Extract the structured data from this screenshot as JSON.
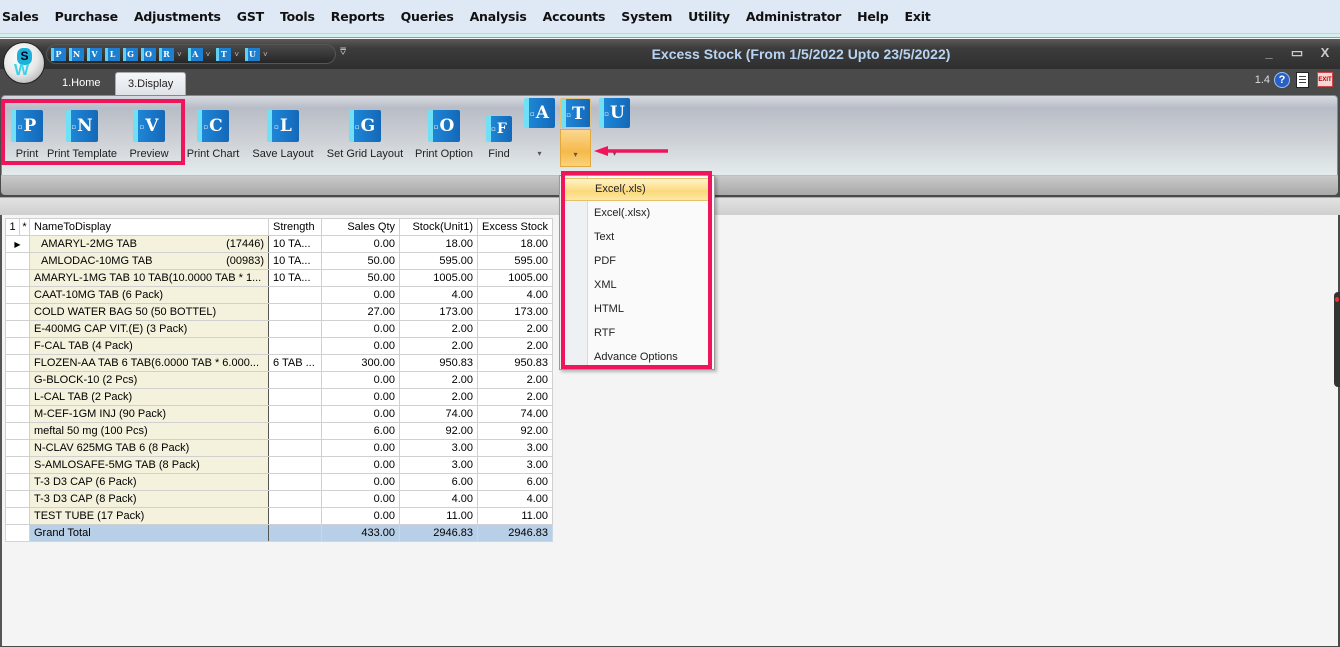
{
  "menu": [
    "Sales",
    "Purchase",
    "Adjustments",
    "GST",
    "Tools",
    "Reports",
    "Queries",
    "Analysis",
    "Accounts",
    "System",
    "Utility",
    "Administrator",
    "Help",
    "Exit"
  ],
  "window": {
    "title": "Excess Stock (From 1/5/2022 Upto 23/5/2022)",
    "controls": {
      "minimize": "_",
      "maximize": "▭",
      "close": "X"
    },
    "version": "1.4",
    "logo_letter": "S",
    "logo_mark": "W"
  },
  "quick_access": [
    {
      "letter": "P",
      "has_menu": false
    },
    {
      "letter": "N",
      "has_menu": false
    },
    {
      "letter": "V",
      "has_menu": false
    },
    {
      "letter": "L",
      "has_menu": false
    },
    {
      "letter": "G",
      "has_menu": false
    },
    {
      "letter": "O",
      "has_menu": false
    },
    {
      "letter": "R",
      "has_menu": true
    },
    {
      "letter": "A",
      "has_menu": true
    },
    {
      "letter": "T",
      "has_menu": true
    },
    {
      "letter": "U",
      "has_menu": true
    }
  ],
  "tabs": [
    {
      "label": "1.Home",
      "active": false
    },
    {
      "label": "3.Display",
      "active": true
    }
  ],
  "ribbon": {
    "buttons": [
      {
        "letter": "P",
        "label": "Print"
      },
      {
        "letter": "N",
        "label": "Print Template"
      },
      {
        "letter": "V",
        "label": "Preview"
      },
      {
        "letter": "C",
        "label": "Print Chart"
      },
      {
        "letter": "L",
        "label": "Save Layout"
      },
      {
        "letter": "G",
        "label": "Set Grid Layout"
      },
      {
        "letter": "O",
        "label": "Print Option"
      },
      {
        "letter": "F",
        "label": "Find"
      }
    ],
    "split_buttons": [
      {
        "letter": "A",
        "arrow": "▾"
      },
      {
        "letter": "T",
        "arrow": "▾"
      },
      {
        "letter": "U",
        "arrow": "▾"
      }
    ]
  },
  "export_menu": {
    "items": [
      "Excel(.xls)",
      "Excel(.xlsx)",
      "Text",
      "PDF",
      "XML",
      "HTML",
      "RTF",
      "Advance Options"
    ],
    "hovered": "Excel(.xls)"
  },
  "grid": {
    "header_prefix": [
      "1",
      "*"
    ],
    "columns": [
      "NameToDisplay",
      "Strength",
      "Sales Qty",
      "Stock(Unit1)",
      "Excess Stock"
    ],
    "current_row_marker": "▶",
    "rows": [
      {
        "name": "AMARYL-2MG TAB",
        "code": "(17446)",
        "strength": "10 TA...",
        "sales_qty": "0.00",
        "stock": "18.00",
        "excess": "18.00"
      },
      {
        "name": "AMLODAC-10MG TAB",
        "code": "(00983)",
        "strength": "10 TA...",
        "sales_qty": "50.00",
        "stock": "595.00",
        "excess": "595.00"
      },
      {
        "name": "AMARYL-1MG TAB 10 TAB(10.0000 TAB * 1...",
        "code": "",
        "strength": "10 TA...",
        "sales_qty": "50.00",
        "stock": "1005.00",
        "excess": "1005.00"
      },
      {
        "name": "CAAT-10MG TAB (6 Pack)",
        "code": "",
        "strength": "",
        "sales_qty": "0.00",
        "stock": "4.00",
        "excess": "4.00"
      },
      {
        "name": "COLD WATER BAG 50 (50 BOTTEL)",
        "code": "",
        "strength": "",
        "sales_qty": "27.00",
        "stock": "173.00",
        "excess": "173.00"
      },
      {
        "name": "E-400MG CAP VIT.(E) (3 Pack)",
        "code": "",
        "strength": "",
        "sales_qty": "0.00",
        "stock": "2.00",
        "excess": "2.00"
      },
      {
        "name": "F-CAL TAB (4 Pack)",
        "code": "",
        "strength": "",
        "sales_qty": "0.00",
        "stock": "2.00",
        "excess": "2.00"
      },
      {
        "name": "FLOZEN-AA TAB 6 TAB(6.0000 TAB * 6.000...",
        "code": "",
        "strength": "6 TAB ...",
        "sales_qty": "300.00",
        "stock": "950.83",
        "excess": "950.83"
      },
      {
        "name": "G-BLOCK-10 (2 Pcs)",
        "code": "",
        "strength": "",
        "sales_qty": "0.00",
        "stock": "2.00",
        "excess": "2.00"
      },
      {
        "name": "L-CAL TAB (2 Pack)",
        "code": "",
        "strength": "",
        "sales_qty": "0.00",
        "stock": "2.00",
        "excess": "2.00"
      },
      {
        "name": "M-CEF-1GM INJ (90 Pack)",
        "code": "",
        "strength": "",
        "sales_qty": "0.00",
        "stock": "74.00",
        "excess": "74.00"
      },
      {
        "name": "meftal 50 mg (100 Pcs)",
        "code": "",
        "strength": "",
        "sales_qty": "6.00",
        "stock": "92.00",
        "excess": "92.00"
      },
      {
        "name": "N-CLAV 625MG TAB  6 (8 Pack)",
        "code": "",
        "strength": "",
        "sales_qty": "0.00",
        "stock": "3.00",
        "excess": "3.00"
      },
      {
        "name": "S-AMLOSAFE-5MG TAB (8 Pack)",
        "code": "",
        "strength": "",
        "sales_qty": "0.00",
        "stock": "3.00",
        "excess": "3.00"
      },
      {
        "name": "T-3 D3 CAP (6 Pack)",
        "code": "",
        "strength": "",
        "sales_qty": "0.00",
        "stock": "6.00",
        "excess": "6.00"
      },
      {
        "name": "T-3 D3 CAP (8 Pack)",
        "code": "",
        "strength": "",
        "sales_qty": "0.00",
        "stock": "4.00",
        "excess": "4.00"
      },
      {
        "name": "TEST TUBE (17 Pack)",
        "code": "",
        "strength": "",
        "sales_qty": "0.00",
        "stock": "11.00",
        "excess": "11.00"
      }
    ],
    "total": {
      "name": "Grand Total",
      "strength": "",
      "sales_qty": "433.00",
      "stock": "2946.83",
      "excess": "2946.83"
    }
  },
  "colors": {
    "highlight": "#f0145a",
    "title_text": "#b9d4f2",
    "name_column_bg": "#f4f1dc",
    "total_row_bg": "#b8cfe8"
  }
}
